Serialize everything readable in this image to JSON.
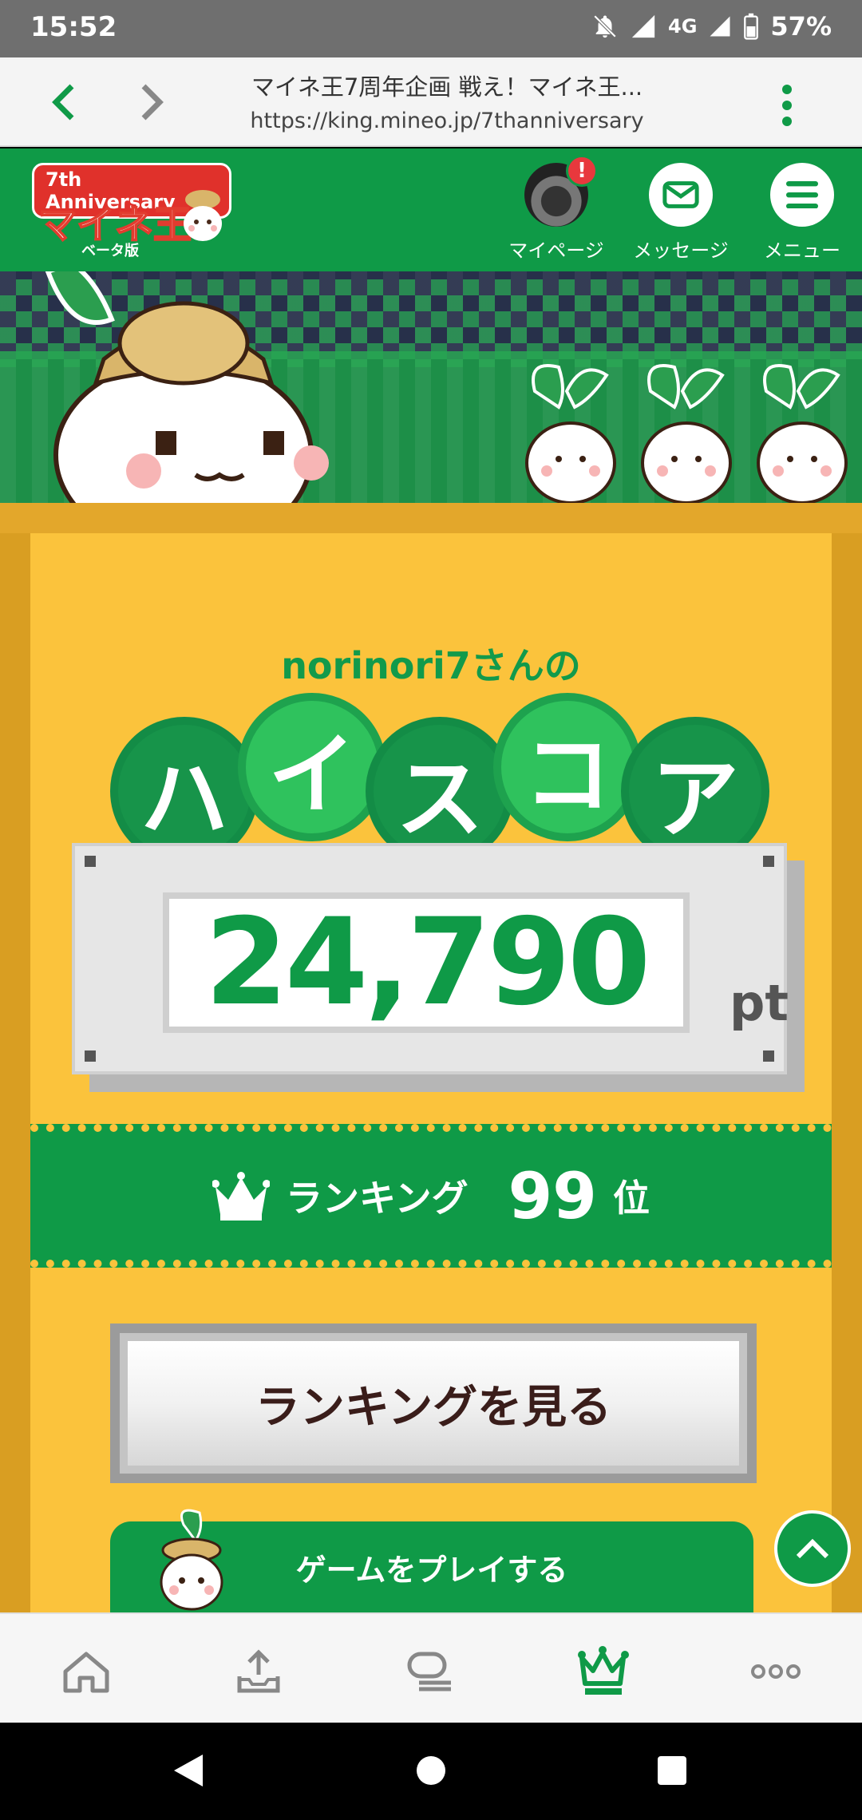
{
  "status_bar": {
    "time": "15:52",
    "network": "4G",
    "battery": "57%"
  },
  "browser": {
    "title": "マイネ王7周年企画 戦え！マイネ王...",
    "url": "https://king.mineo.jp/7thanniversary"
  },
  "site_header": {
    "logo_anniversary": "7th Anniversary",
    "logo_name": "マイネ王",
    "logo_beta": "ベータ版",
    "items": [
      {
        "label": "マイページ",
        "badge": "!"
      },
      {
        "label": "メッセージ"
      },
      {
        "label": "メニュー"
      }
    ]
  },
  "result": {
    "player_line": "norinori7さんの",
    "title_chars": [
      "ハ",
      "イ",
      "ス",
      "コ",
      "ア"
    ],
    "score": "24,790",
    "score_unit": "pt",
    "ranking_label": "ランキング",
    "ranking_value": "99",
    "ranking_unit": "位",
    "ranking_button": "ランキングを見る"
  },
  "play_bar": {
    "label": "ゲームをプレイする"
  },
  "bottom_nav": [
    "home-icon",
    "upload-icon",
    "chat-icon",
    "crown-icon",
    "more-icon"
  ],
  "colors": {
    "brand_green": "#0f9a47",
    "gold": "#fbc33c",
    "frame": "#d99e22"
  }
}
